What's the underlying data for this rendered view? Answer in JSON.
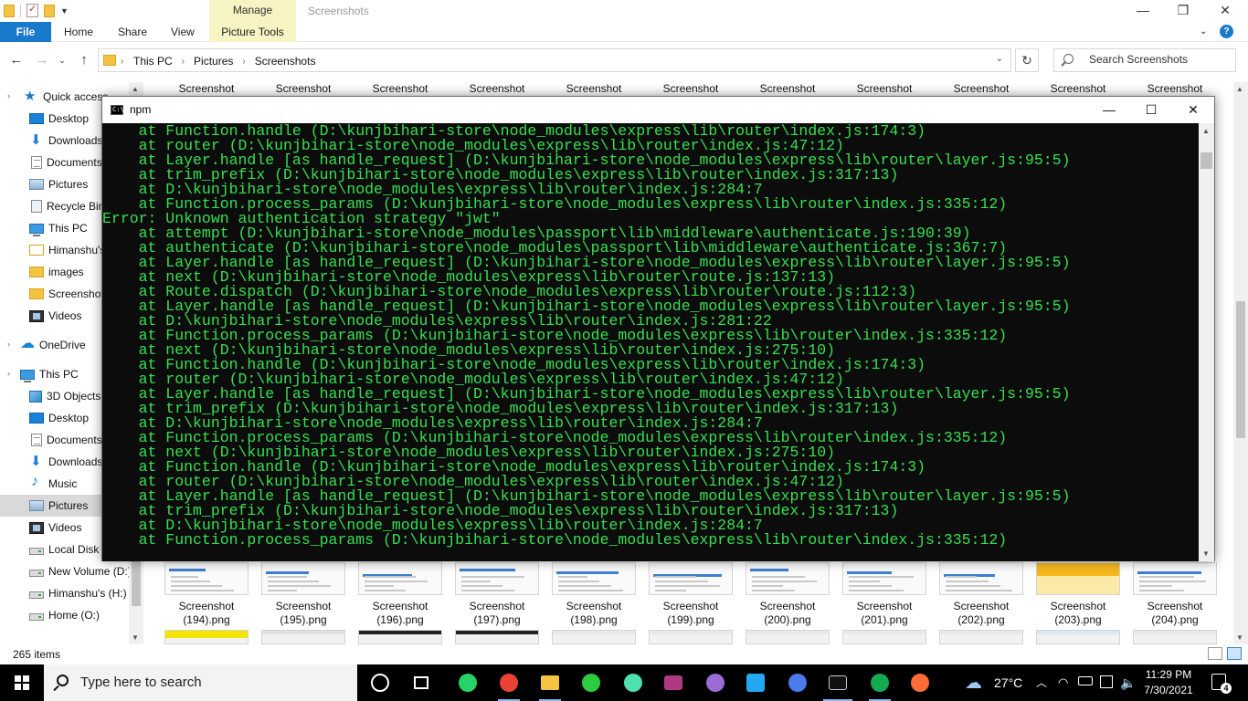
{
  "window": {
    "title": "Screenshots",
    "manage_tab": "Manage",
    "ribbon_tabs": {
      "file": "File",
      "home": "Home",
      "share": "Share",
      "view": "View",
      "picture_tools": "Picture Tools"
    }
  },
  "address_bar": {
    "crumbs": [
      "This PC",
      "Pictures",
      "Screenshots"
    ],
    "search_placeholder": "Search Screenshots"
  },
  "nav_pane": {
    "items": [
      {
        "label": "Quick access",
        "icon": "star-icon"
      },
      {
        "label": "Desktop",
        "icon": "desktop-icon"
      },
      {
        "label": "Downloads",
        "icon": "download-icon"
      },
      {
        "label": "Documents",
        "icon": "document-icon"
      },
      {
        "label": "Pictures",
        "icon": "pictures-icon"
      },
      {
        "label": "Recycle Bin",
        "icon": "recycle-bin-icon"
      },
      {
        "label": "This PC",
        "icon": "computer-icon"
      },
      {
        "label": "Himanshu's",
        "icon": "folder-icon"
      },
      {
        "label": "images",
        "icon": "folder-icon"
      },
      {
        "label": "Screenshot",
        "icon": "folder-icon"
      },
      {
        "label": "Videos",
        "icon": "videos-icon"
      },
      {
        "label": "OneDrive",
        "icon": "cloud-icon"
      },
      {
        "label": "This PC",
        "icon": "computer-icon"
      },
      {
        "label": "3D Objects",
        "icon": "3d-objects-icon"
      },
      {
        "label": "Desktop",
        "icon": "desktop-icon"
      },
      {
        "label": "Documents",
        "icon": "document-icon"
      },
      {
        "label": "Downloads",
        "icon": "download-icon"
      },
      {
        "label": "Music",
        "icon": "music-icon"
      },
      {
        "label": "Pictures",
        "icon": "pictures-icon"
      },
      {
        "label": "Videos",
        "icon": "videos-icon"
      },
      {
        "label": "Local Disk (C:)",
        "icon": "drive-icon"
      },
      {
        "label": "New Volume (D:)",
        "icon": "drive-icon"
      },
      {
        "label": "Himanshu's (H:)",
        "icon": "drive-icon"
      },
      {
        "label": "Home (O:)",
        "icon": "drive-icon"
      }
    ]
  },
  "files": {
    "top_row_label": "Screenshot",
    "bottom_row": [
      {
        "line1": "Screenshot",
        "line2": "(194).png"
      },
      {
        "line1": "Screenshot",
        "line2": "(195).png"
      },
      {
        "line1": "Screenshot",
        "line2": "(196).png"
      },
      {
        "line1": "Screenshot",
        "line2": "(197).png"
      },
      {
        "line1": "Screenshot",
        "line2": "(198).png"
      },
      {
        "line1": "Screenshot",
        "line2": "(199).png"
      },
      {
        "line1": "Screenshot",
        "line2": "(200).png"
      },
      {
        "line1": "Screenshot",
        "line2": "(201).png"
      },
      {
        "line1": "Screenshot",
        "line2": "(202).png"
      },
      {
        "line1": "Screenshot",
        "line2": "(203).png"
      },
      {
        "line1": "Screenshot",
        "line2": "(204).png"
      }
    ]
  },
  "status_bar": {
    "item_count": "265 items"
  },
  "console": {
    "title": "npm",
    "icon_text": "C:\\_",
    "text_color": "#35e04f",
    "lines": [
      "    at Function.handle (D:\\kunjbihari-store\\node_modules\\express\\lib\\router\\index.js:174:3)",
      "    at router (D:\\kunjbihari-store\\node_modules\\express\\lib\\router\\index.js:47:12)",
      "    at Layer.handle [as handle_request] (D:\\kunjbihari-store\\node_modules\\express\\lib\\router\\layer.js:95:5)",
      "    at trim_prefix (D:\\kunjbihari-store\\node_modules\\express\\lib\\router\\index.js:317:13)",
      "    at D:\\kunjbihari-store\\node_modules\\express\\lib\\router\\index.js:284:7",
      "    at Function.process_params (D:\\kunjbihari-store\\node_modules\\express\\lib\\router\\index.js:335:12)",
      "Error: Unknown authentication strategy \"jwt\"",
      "    at attempt (D:\\kunjbihari-store\\node_modules\\passport\\lib\\middleware\\authenticate.js:190:39)",
      "    at authenticate (D:\\kunjbihari-store\\node_modules\\passport\\lib\\middleware\\authenticate.js:367:7)",
      "    at Layer.handle [as handle_request] (D:\\kunjbihari-store\\node_modules\\express\\lib\\router\\layer.js:95:5)",
      "    at next (D:\\kunjbihari-store\\node_modules\\express\\lib\\router\\route.js:137:13)",
      "    at Route.dispatch (D:\\kunjbihari-store\\node_modules\\express\\lib\\router\\route.js:112:3)",
      "    at Layer.handle [as handle_request] (D:\\kunjbihari-store\\node_modules\\express\\lib\\router\\layer.js:95:5)",
      "    at D:\\kunjbihari-store\\node_modules\\express\\lib\\router\\index.js:281:22",
      "    at Function.process_params (D:\\kunjbihari-store\\node_modules\\express\\lib\\router\\index.js:335:12)",
      "    at next (D:\\kunjbihari-store\\node_modules\\express\\lib\\router\\index.js:275:10)",
      "    at Function.handle (D:\\kunjbihari-store\\node_modules\\express\\lib\\router\\index.js:174:3)",
      "    at router (D:\\kunjbihari-store\\node_modules\\express\\lib\\router\\index.js:47:12)",
      "    at Layer.handle [as handle_request] (D:\\kunjbihari-store\\node_modules\\express\\lib\\router\\layer.js:95:5)",
      "    at trim_prefix (D:\\kunjbihari-store\\node_modules\\express\\lib\\router\\index.js:317:13)",
      "    at D:\\kunjbihari-store\\node_modules\\express\\lib\\router\\index.js:284:7",
      "    at Function.process_params (D:\\kunjbihari-store\\node_modules\\express\\lib\\router\\index.js:335:12)",
      "    at next (D:\\kunjbihari-store\\node_modules\\express\\lib\\router\\index.js:275:10)",
      "    at Function.handle (D:\\kunjbihari-store\\node_modules\\express\\lib\\router\\index.js:174:3)",
      "    at router (D:\\kunjbihari-store\\node_modules\\express\\lib\\router\\index.js:47:12)",
      "    at Layer.handle [as handle_request] (D:\\kunjbihari-store\\node_modules\\express\\lib\\router\\layer.js:95:5)",
      "    at trim_prefix (D:\\kunjbihari-store\\node_modules\\express\\lib\\router\\index.js:317:13)",
      "    at D:\\kunjbihari-store\\node_modules\\express\\lib\\router\\index.js:284:7",
      "    at Function.process_params (D:\\kunjbihari-store\\node_modules\\express\\lib\\router\\index.js:335:12)"
    ]
  },
  "taskbar": {
    "search_placeholder": "Type here to search",
    "apps": [
      {
        "name": "cortana-icon",
        "color": "#ffffff"
      },
      {
        "name": "task-view-icon",
        "color": "#ffffff"
      },
      {
        "name": "whatsapp-icon",
        "color": "#25d366"
      },
      {
        "name": "chrome-icon",
        "color": "#ea4335"
      },
      {
        "name": "file-explorer-icon",
        "color": "#f3c442"
      },
      {
        "name": "sync-app-icon",
        "color": "#2ecc40"
      },
      {
        "name": "atom-icon",
        "color": "#4fe0b0"
      },
      {
        "name": "terminal-app-icon",
        "color": "#b03a82"
      },
      {
        "name": "github-icon",
        "color": "#9b6cd6"
      },
      {
        "name": "vscode-icon",
        "color": "#23a9f2"
      },
      {
        "name": "chrome-notifications-icon",
        "color": "#4b7bec"
      },
      {
        "name": "command-prompt-icon",
        "color": "#cccccc"
      },
      {
        "name": "mongodb-icon",
        "color": "#13aa52"
      },
      {
        "name": "postman-icon",
        "color": "#ff6c37"
      }
    ],
    "weather": "27°C",
    "time": "11:29 PM",
    "date": "7/30/2021",
    "notification_count": "4"
  }
}
